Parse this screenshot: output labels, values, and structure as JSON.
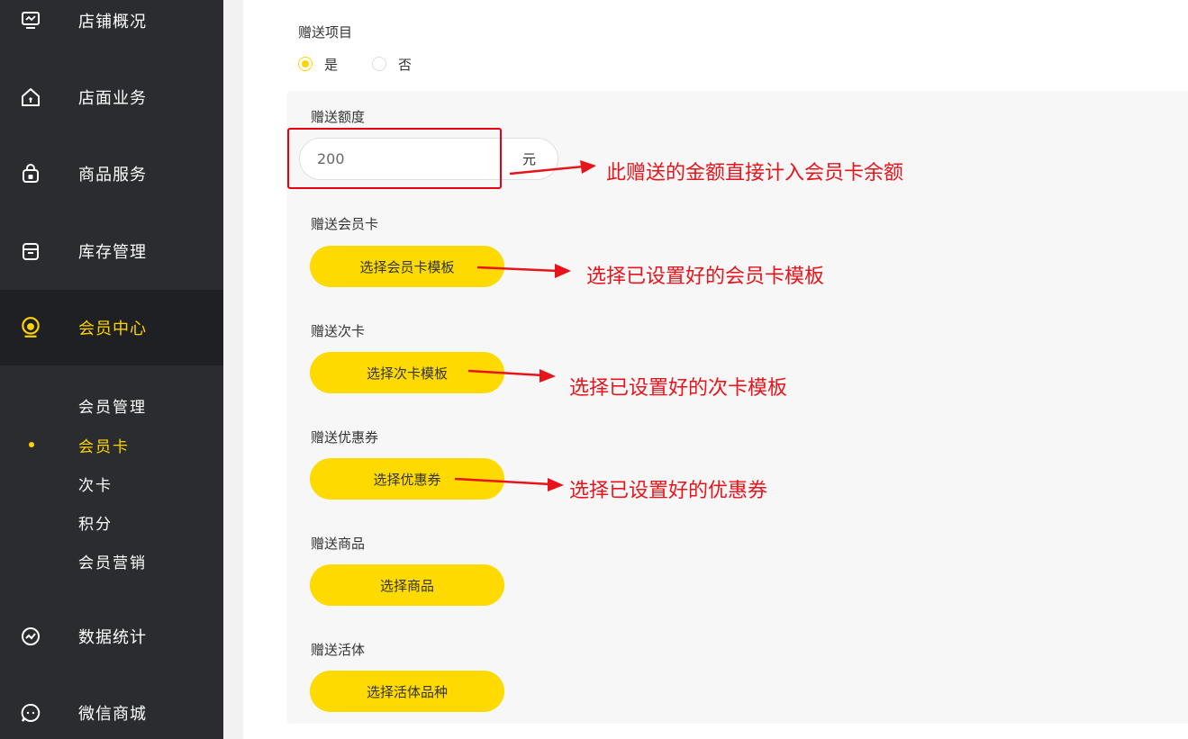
{
  "sidebar": {
    "items": [
      {
        "label": "店铺概况",
        "icon": "monitor-icon"
      },
      {
        "label": "店面业务",
        "icon": "home-icon"
      },
      {
        "label": "商品服务",
        "icon": "shopping-bag-icon"
      },
      {
        "label": "库存管理",
        "icon": "archive-icon"
      },
      {
        "label": "会员中心",
        "icon": "member-icon"
      },
      {
        "label": "数据统计",
        "icon": "chart-icon"
      },
      {
        "label": "微信商城",
        "icon": "chat-icon"
      }
    ],
    "subitems": [
      {
        "label": "会员管理"
      },
      {
        "label": "会员卡"
      },
      {
        "label": "次卡"
      },
      {
        "label": "积分"
      },
      {
        "label": "会员营销"
      }
    ],
    "active_item": "会员中心",
    "active_subitem": "会员卡"
  },
  "form": {
    "gift_items_label": "赠送项目",
    "radio_yes": "是",
    "radio_no": "否",
    "radio_selected": "是",
    "amount_label": "赠送额度",
    "amount_value": "200",
    "amount_unit": "元",
    "card_label": "赠送会员卡",
    "card_button": "选择会员卡模板",
    "times_card_label": "赠送次卡",
    "times_card_button": "选择次卡模板",
    "coupon_label": "赠送优惠券",
    "coupon_button": "选择优惠券",
    "goods_label": "赠送商品",
    "goods_button": "选择商品",
    "pet_label": "赠送活体",
    "pet_button": "选择活体品种"
  },
  "annotations": {
    "amount": "此赠送的金额直接计入会员卡余额",
    "card": "选择已设置好的会员卡模板",
    "times_card": "选择已设置好的次卡模板",
    "coupon": "选择已设置好的优惠券"
  },
  "colors": {
    "accent": "#ffd400",
    "button": "#ffda00",
    "sidebar": "#2b2c30",
    "annotation": "#e8141b"
  }
}
